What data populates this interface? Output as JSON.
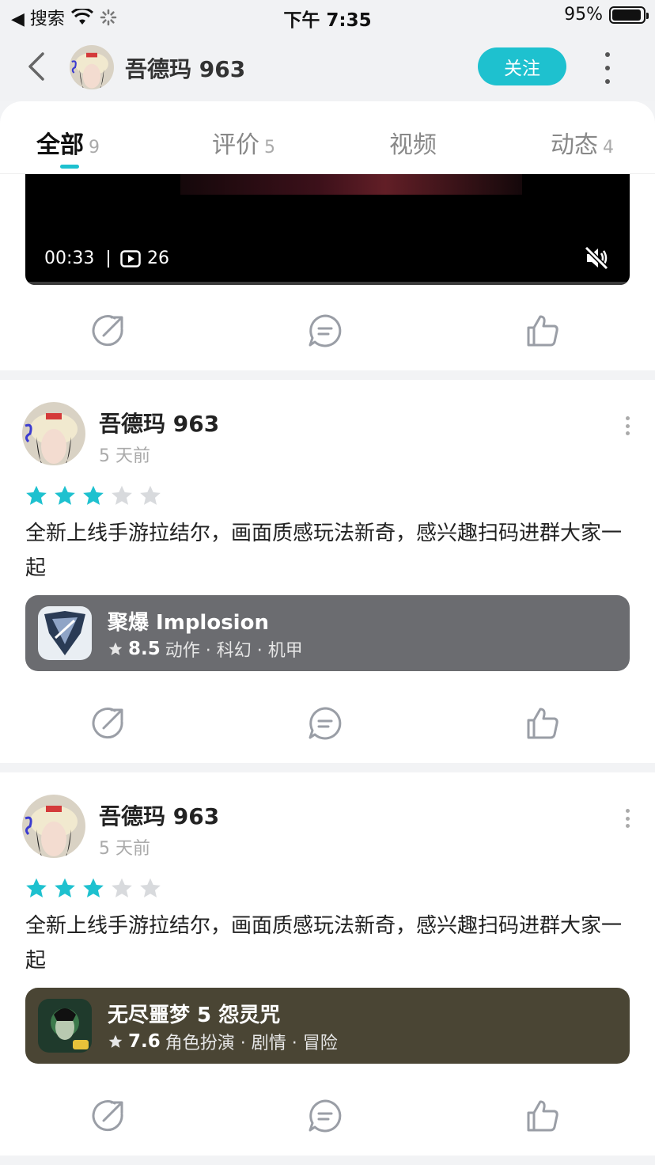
{
  "status_bar": {
    "back_app": "◀ 搜索",
    "time": "下午 7:35",
    "battery": "95%",
    "battery_level": 0.95
  },
  "header": {
    "username": "吾德玛 963",
    "follow_label": "关注"
  },
  "tabs": [
    {
      "label": "全部",
      "count": "9",
      "active": true
    },
    {
      "label": "评价",
      "count": "5",
      "active": false
    },
    {
      "label": "视频",
      "count": "",
      "active": false
    },
    {
      "label": "动态",
      "count": "4",
      "active": false
    }
  ],
  "video_post": {
    "duration": "00:33",
    "play_count": "26"
  },
  "reviews": [
    {
      "author": "吾德玛 963",
      "time": "5 天前",
      "rating": 3,
      "max_rating": 5,
      "text": "全新上线手游拉结尔，画面质感玩法新奇，感兴趣扫码进群大家一起",
      "game": {
        "title": "聚爆 Implosion",
        "score": "8.5",
        "tags": "动作 · 科幻 · 机甲",
        "box_color": "#6b6c70"
      }
    },
    {
      "author": "吾德玛 963",
      "time": "5 天前",
      "rating": 3,
      "max_rating": 5,
      "text": "全新上线手游拉结尔，画面质感玩法新奇，感兴趣扫码进群大家一起",
      "game": {
        "title": "无尽噩梦 5 怨灵咒",
        "score": "7.6",
        "tags": "角色扮演 · 剧情 · 冒险",
        "box_color": "#4a4534"
      }
    }
  ],
  "colors": {
    "accent": "#1ec1cf",
    "star_on": "#1ec1cf",
    "star_off": "#d8dadd"
  },
  "icons": {
    "share": "share-icon",
    "comment": "comment-icon",
    "like": "thumbs-up-icon",
    "mute": "mute-icon",
    "back": "chevron-left-icon",
    "more": "more-vertical-icon"
  }
}
